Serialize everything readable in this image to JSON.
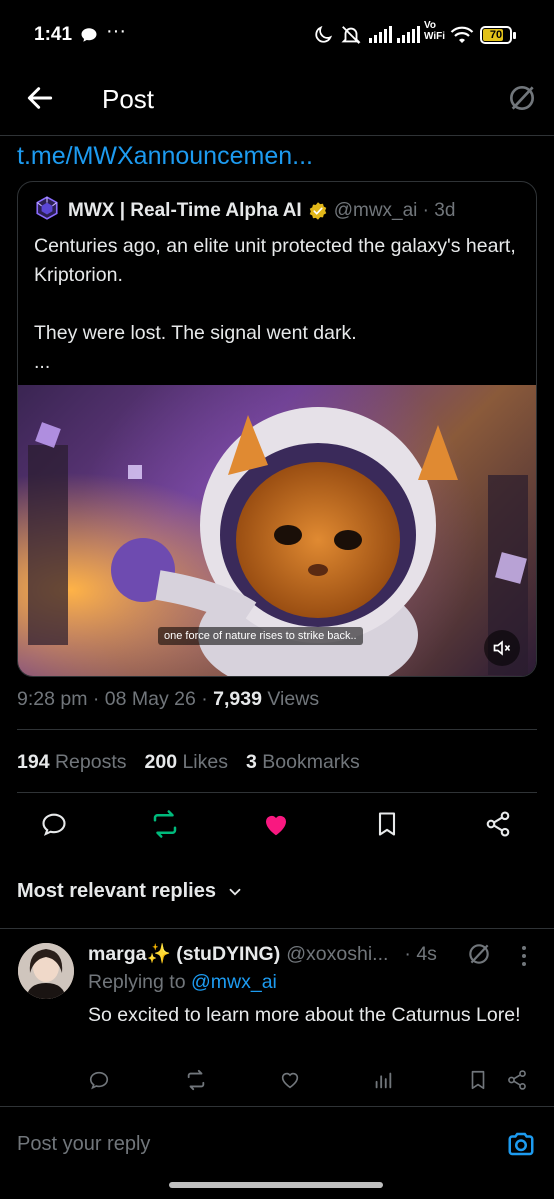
{
  "status_bar": {
    "time": "1:41",
    "dots": "···",
    "vo_wifi": "Vo\nWiFi",
    "battery": "70"
  },
  "header": {
    "title": "Post",
    "back_icon": "arrow-left-icon",
    "grok_icon": "grok-icon"
  },
  "post": {
    "link_text": "t.me/MWXannouncemen..."
  },
  "quote": {
    "name": "MWX | Real-Time Alpha AI",
    "handle_time": "@mwx_ai · 3d",
    "text": "Centuries ago, an elite unit protected the galaxy's heart, Kriptorion.\n\nThey were lost. The signal went dark.\n...",
    "subtitle": "one force of nature rises to strike back..",
    "verified_color": "#e2b719"
  },
  "meta": {
    "time_date": "9:28 pm · 08 May 26 · ",
    "views_count": "7,939",
    "views_label": " Views"
  },
  "stats": {
    "reposts_count": "194",
    "reposts_label": " Reposts",
    "likes_count": "200",
    "likes_label": " Likes",
    "bookmarks_count": "3",
    "bookmarks_label": " Bookmarks"
  },
  "actions": {
    "repost_color": "#00ba7c",
    "like_color": "#f91880"
  },
  "replies_filter": {
    "label": "Most relevant replies"
  },
  "reply": {
    "name": "marga✨ (stuDYING)",
    "handle": "@xoxoshi...",
    "time": "· 4s",
    "replying_prefix": "Replying to ",
    "replying_to": "@mwx_ai",
    "text": "So excited to learn more about the Caturnus Lore!"
  },
  "composer": {
    "placeholder": "Post your reply"
  },
  "colors": {
    "accent": "#1d9bf0",
    "background": "#000000",
    "muted": "#71767b"
  }
}
